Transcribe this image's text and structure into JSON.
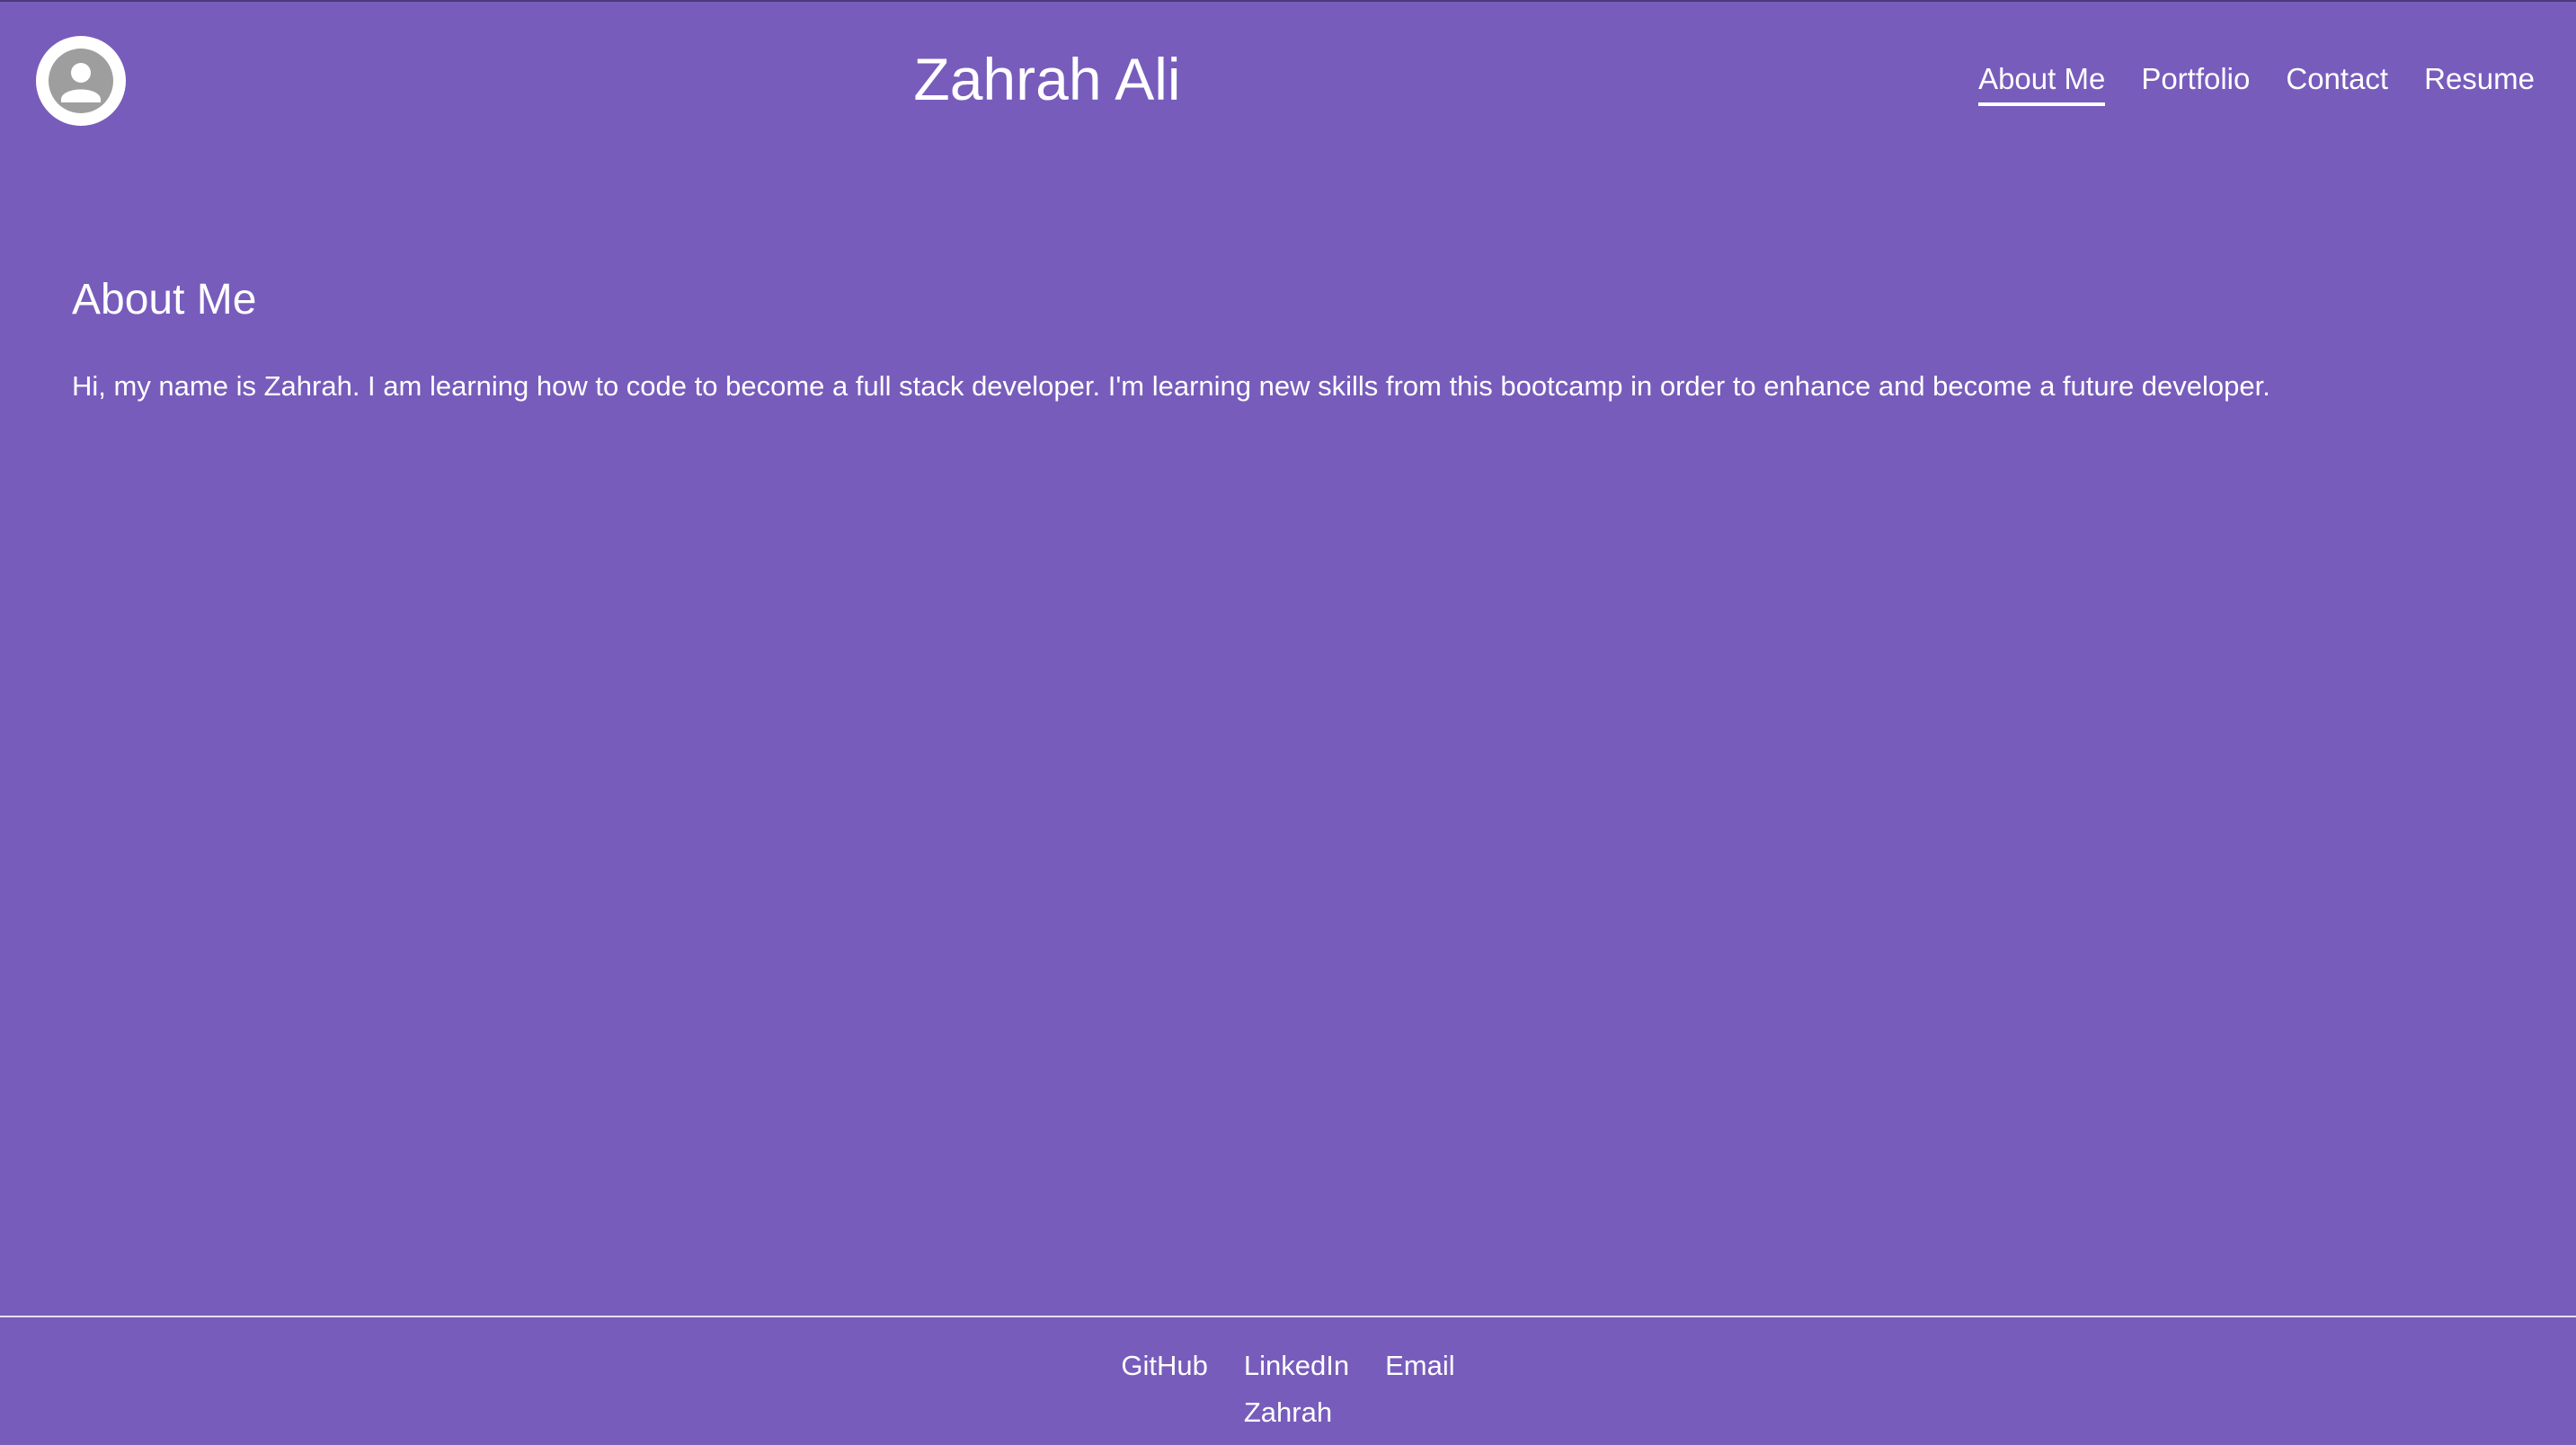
{
  "header": {
    "title": "Zahrah Ali",
    "avatar_icon": "user-icon",
    "nav": [
      {
        "label": "About Me",
        "active": true
      },
      {
        "label": "Portfolio",
        "active": false
      },
      {
        "label": "Contact",
        "active": false
      },
      {
        "label": "Resume",
        "active": false
      }
    ]
  },
  "main": {
    "heading": "About Me",
    "body": "Hi, my name is Zahrah. I am learning how to code to become a full stack developer. I'm learning new skills from this bootcamp in order to enhance and become a future developer."
  },
  "footer": {
    "links": [
      "GitHub",
      "LinkedIn",
      "Email"
    ],
    "name": "Zahrah"
  },
  "colors": {
    "background": "#775cbc",
    "text": "#ffffff",
    "avatar_gray": "#9e9e9e"
  }
}
